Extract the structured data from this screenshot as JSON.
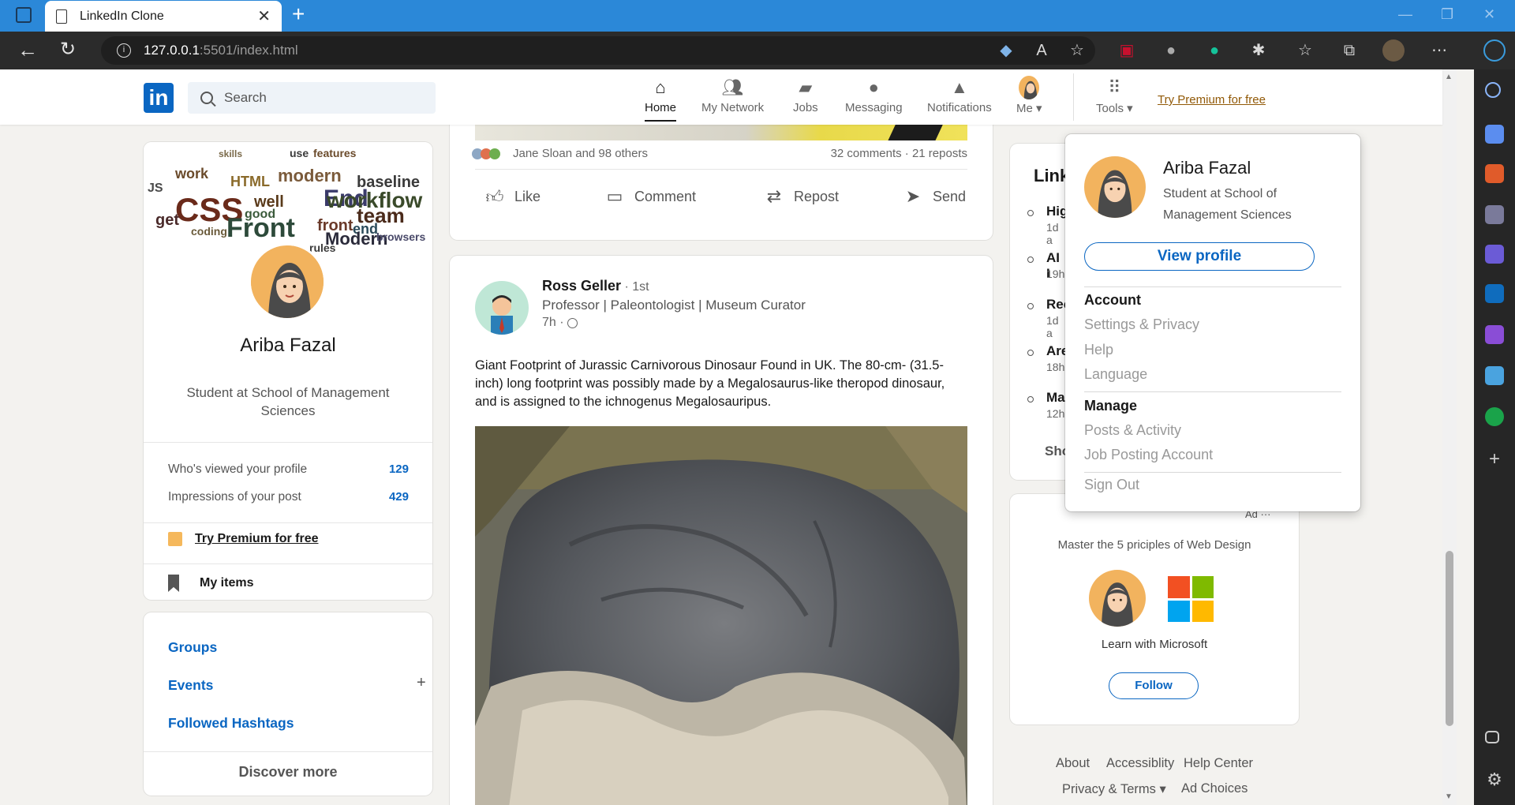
{
  "browser": {
    "tab_title": "LinkedIn Clone",
    "url_host": "127.0.0.1",
    "url_rest": ":5501/index.html"
  },
  "header": {
    "search_placeholder": "Search",
    "nav": [
      {
        "label": "Home",
        "icon": "home-icon"
      },
      {
        "label": "My Network",
        "icon": "network-icon"
      },
      {
        "label": "Jobs",
        "icon": "briefcase-icon"
      },
      {
        "label": "Messaging",
        "icon": "chat-icon"
      },
      {
        "label": "Notifications",
        "icon": "bell-icon"
      },
      {
        "label": "Me ▾",
        "icon": "avatar"
      },
      {
        "label": "Tools ▾",
        "icon": "grid-icon"
      }
    ],
    "premium": "Try Premium for free"
  },
  "profile": {
    "name": "Ariba Fazal",
    "headline": "Student at School of Management Sciences",
    "stats": [
      {
        "label": "Who's viewed your profile",
        "value": "129"
      },
      {
        "label": "Impressions of your post",
        "value": "429"
      }
    ],
    "premium": "Try Premium for free",
    "my_items": "My items",
    "links": [
      "Groups",
      "Events",
      "Followed Hashtags"
    ],
    "discover": "Discover more"
  },
  "prev_post": {
    "reactions": "Jane Sloan and 98 others",
    "counts": "32 comments · 21 reposts",
    "actions": [
      "Like",
      "Comment",
      "Repost",
      "Send"
    ]
  },
  "post": {
    "author": "Ross Geller",
    "degree": " · 1st",
    "subtitle": "Professor | Paleontologist | Museum Curator",
    "time": "7h · ",
    "text": "Giant Footprint of Jurassic Carnivorous Dinosaur Found in UK. The 80-cm- (31.5-inch) long footprint was possibly made by a Megalosaurus-like theropod dinosaur, and is assigned to the ichnogenus Megalosauripus."
  },
  "news": {
    "title": "Link",
    "items": [
      {
        "title": "Hig",
        "meta": "1d a"
      },
      {
        "title": "AI I",
        "meta": "19h"
      },
      {
        "title": "Rec",
        "meta": "1d a"
      },
      {
        "title": "Are",
        "meta": "18h"
      },
      {
        "title": "Ma",
        "meta": "12h"
      }
    ],
    "show": "Sho"
  },
  "ad": {
    "tag": "Ad ···",
    "title": "Master the 5 priciples of Web Design",
    "caption": "Learn with Microsoft",
    "follow": "Follow"
  },
  "footer": {
    "links": [
      "About",
      "Accessiblity",
      "Help Center",
      "Privacy & Terms ▾",
      "Ad Choices"
    ]
  },
  "dropdown": {
    "name": "Ariba Fazal",
    "headline": "Student at School of Management Sciences",
    "view_profile": "View profile",
    "account_head": "Account",
    "account_items": [
      "Settings & Privacy",
      "Help",
      "Language"
    ],
    "manage_head": "Manage",
    "manage_items": [
      "Posts & Activity",
      "Job Posting Account"
    ],
    "sign_out": "Sign Out"
  },
  "colors": {
    "linkedin_blue": "#0a66c2",
    "premium_gold": "#915907",
    "page_bg": "#f3f2ef"
  }
}
